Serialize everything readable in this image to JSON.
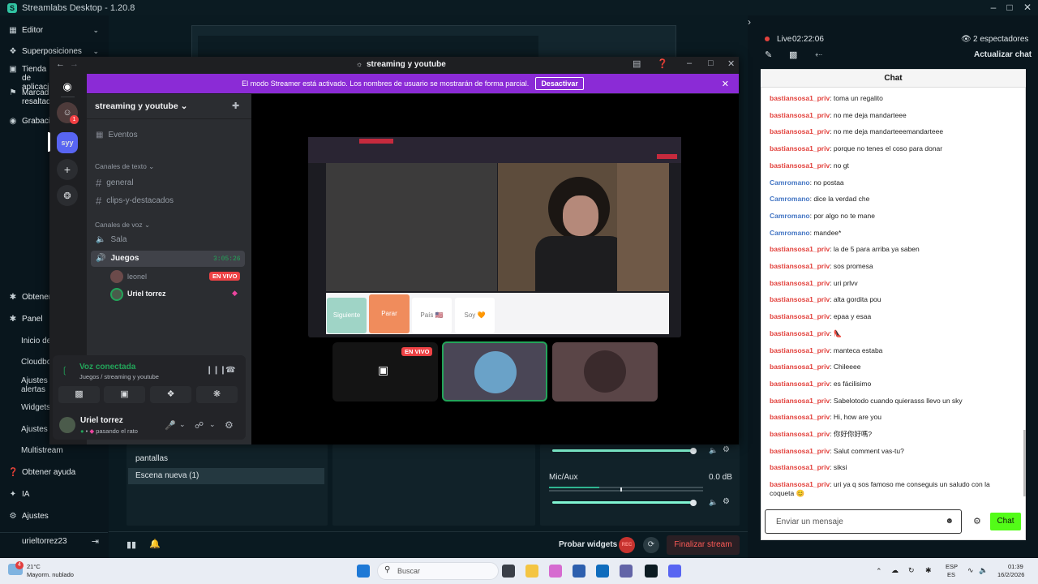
{
  "app": {
    "title": "Streamlabs Desktop - 1.20.8"
  },
  "nav": {
    "items": [
      {
        "label": "Editor",
        "icon": "editor-icon"
      },
      {
        "label": "Superposiciones",
        "icon": "overlays-icon"
      },
      {
        "label": "Tienda de aplicaci",
        "icon": "store-icon"
      },
      {
        "label": "Marcad resaltad",
        "icon": "highlight-icon"
      },
      {
        "label": "Grabaci",
        "icon": "record-icon"
      },
      {
        "label": "Obtener",
        "icon": "get-icon"
      },
      {
        "label": "Panel",
        "icon": "panel-icon"
      }
    ],
    "sub_items": [
      "Inicio de",
      "Cloudbo",
      "Ajustes alertas",
      "Widgets",
      "Ajustes",
      "Multistream"
    ],
    "bottom": {
      "help": "Obtener ayuda",
      "ai": "IA",
      "settings": "Ajustes",
      "username": "urieltorrez23"
    }
  },
  "scenes": {
    "items": [
      "pantallas",
      "Escena nueva (1)"
    ]
  },
  "mixer": {
    "channel_label": "Mic/Aux",
    "channel_db": "0.0 dB"
  },
  "footer": {
    "test_widgets": "Probar widgets",
    "rec_label": "REC",
    "end_stream": "Finalizar stream"
  },
  "stream": {
    "live_label": "Live",
    "live_time": "02:22:06",
    "viewers": "2 espectadores",
    "refresh_chat": "Actualizar chat",
    "chat_title": "Chat"
  },
  "chat": {
    "messages": [
      {
        "user": "bastiansosa1_priv",
        "color": "red",
        "text": ": toma un regalito"
      },
      {
        "user": "bastiansosa1_priv",
        "color": "red",
        "text": ": no me deja mandarteee"
      },
      {
        "user": "bastiansosa1_priv",
        "color": "red",
        "text": ": no me deja mandarteeemandarteee"
      },
      {
        "user": "bastiansosa1_priv",
        "color": "red",
        "text": ": porque no tenes el coso para donar"
      },
      {
        "user": "bastiansosa1_priv",
        "color": "red",
        "text": ": no gt"
      },
      {
        "user": "Camromano",
        "color": "blue",
        "text": ": no postaa"
      },
      {
        "user": "Camromano",
        "color": "blue",
        "text": ": dice la verdad che"
      },
      {
        "user": "Camromano",
        "color": "blue",
        "text": ": por algo no te mane"
      },
      {
        "user": "Camromano",
        "color": "blue",
        "text": ": mandee*"
      },
      {
        "user": "bastiansosa1_priv",
        "color": "red",
        "text": ": la de 5 para arriba ya saben"
      },
      {
        "user": "bastiansosa1_priv",
        "color": "red",
        "text": ": sos promesa"
      },
      {
        "user": "bastiansosa1_priv",
        "color": "red",
        "text": ": uri prlvv"
      },
      {
        "user": "bastiansosa1_priv",
        "color": "red",
        "text": ": alta gordita pou"
      },
      {
        "user": "bastiansosa1_priv",
        "color": "red",
        "text": ": epaa y esaa"
      },
      {
        "user": "bastiansosa1_priv",
        "color": "red",
        "text": ": 👠"
      },
      {
        "user": "bastiansosa1_priv",
        "color": "red",
        "text": ": manteca estaba"
      },
      {
        "user": "bastiansosa1_priv",
        "color": "red",
        "text": ": Chileeee"
      },
      {
        "user": "bastiansosa1_priv",
        "color": "red",
        "text": ": es fácilisimo"
      },
      {
        "user": "bastiansosa1_priv",
        "color": "red",
        "text": ": Sabelotodo cuando quierasss llevo un sky"
      },
      {
        "user": "bastiansosa1_priv",
        "color": "red",
        "text": ": Hi, how are you"
      },
      {
        "user": "bastiansosa1_priv",
        "color": "red",
        "text": ": 你好你好嗎?"
      },
      {
        "user": "bastiansosa1_priv",
        "color": "red",
        "text": ": Salut comment vas-tu?"
      },
      {
        "user": "bastiansosa1_priv",
        "color": "red",
        "text": ": siksi"
      },
      {
        "user": "bastiansosa1_priv",
        "color": "red",
        "text": ": uri ya q sos famoso me conseguis un saludo con la coqueta 😊"
      }
    ],
    "input_placeholder": "Enviar un mensaje",
    "send_button": "Chat"
  },
  "discord": {
    "window_title": "streaming y youtube",
    "banner_text": "El modo Streamer está activado. Los nombres de usuario se mostrarán de forma parcial.",
    "banner_button": "Desactivar",
    "server_name": "streaming y youtube",
    "server_badge": "syy",
    "events": "Eventos",
    "text_category": "Canales de texto",
    "text_channels": [
      "general",
      "clips-y-destacados"
    ],
    "voice_category": "Canales de voz",
    "voice_channels": [
      "Sala",
      "Juegos"
    ],
    "voice_timer": "3:05:26",
    "voice_users": [
      {
        "name": "leonel",
        "badge": "EN VIVO"
      },
      {
        "name": "Uriel torrez",
        "badge": ""
      }
    ],
    "voice_status": "Voz conectada",
    "voice_location": "Juegos / streaming y youtube",
    "user_name": "Uriel torrez",
    "user_status": "pasando el rato",
    "live_badge": "EN VIVO",
    "stream_buttons": [
      "Siguiente",
      "Parar",
      "País 🇺🇸",
      "Soy 🧡"
    ]
  },
  "taskbar": {
    "weather_temp": "21°C",
    "weather_desc": "Mayorm. nublado",
    "weather_badge": "4",
    "search": "Buscar",
    "lang_top": "ESP",
    "lang_bottom": "ES",
    "time": "01:39",
    "date": "16/2/2026"
  }
}
